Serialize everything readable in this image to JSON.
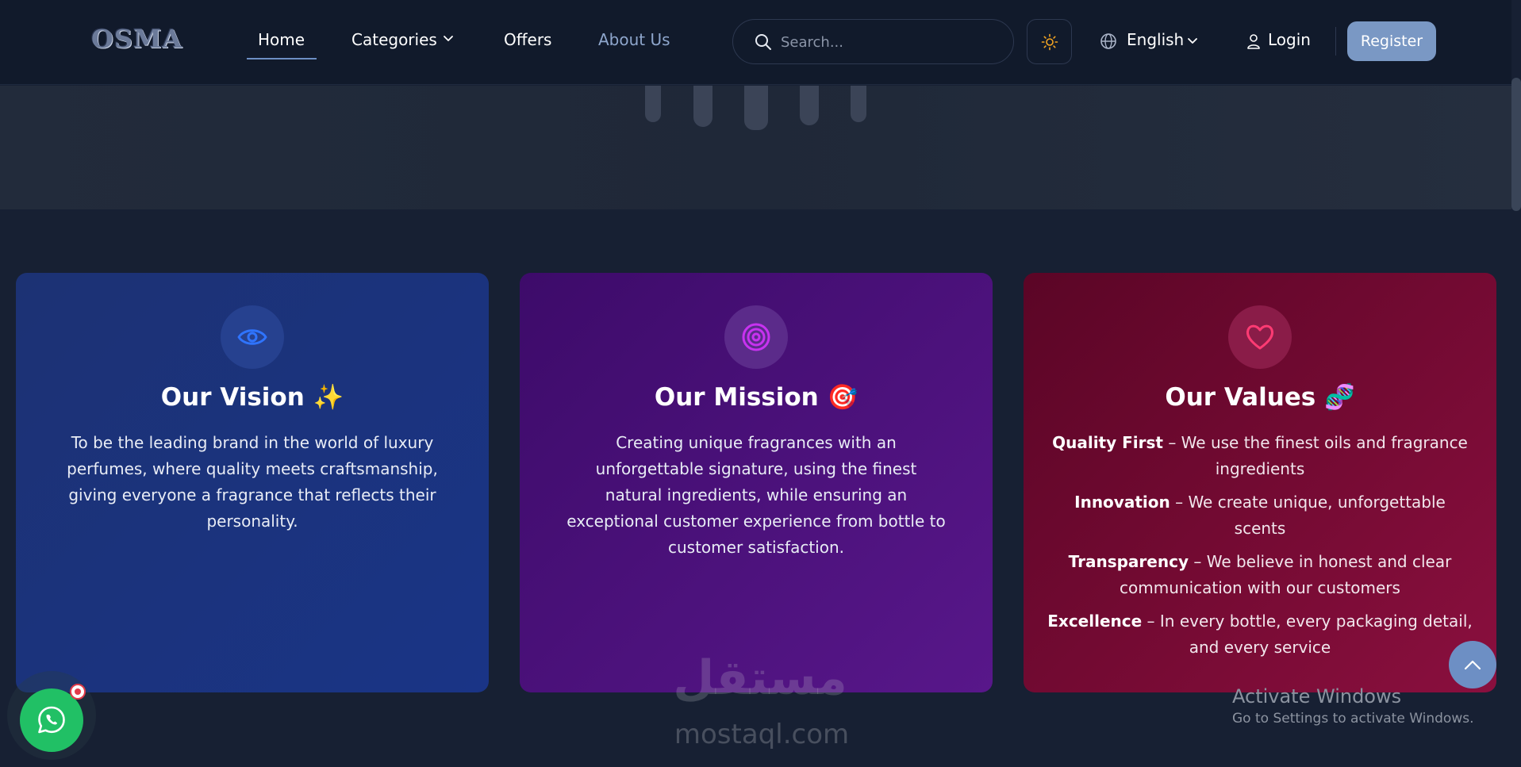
{
  "nav": {
    "logo": "OSMA",
    "links": {
      "home": "Home",
      "categories": "Categories",
      "offers": "Offers",
      "about": "About Us"
    },
    "search_placeholder": "Search...",
    "language": "English",
    "login": "Login",
    "register": "Register"
  },
  "cards": {
    "vision": {
      "title": "Our Vision ✨",
      "body": "To be the leading brand in the world of luxury perfumes, where quality meets craftsmanship, giving everyone a fragrance that reflects their personality."
    },
    "mission": {
      "title": "Our Mission 🎯",
      "body": "Creating unique fragrances with an unforgettable signature, using the finest natural ingredients, while ensuring an exceptional customer experience from bottle to customer satisfaction."
    },
    "values": {
      "title": "Our Values 🧬",
      "items": [
        {
          "name": "Quality First",
          "text": " – We use the finest oils and fragrance ingredients"
        },
        {
          "name": "Innovation",
          "text": " – We create unique, unforgettable scents"
        },
        {
          "name": "Transparency",
          "text": " – We believe in honest and clear communication with our customers"
        },
        {
          "name": "Excellence",
          "text": " – In every bottle, every packaging detail, and every service"
        }
      ]
    }
  },
  "watermark": {
    "arabic": "مستقل",
    "latin": "mostaql.com"
  },
  "windows_activation": {
    "title": "Activate Windows",
    "subtitle": "Go to Settings to activate Windows."
  },
  "icons": {
    "search": "search-icon",
    "theme": "sun-icon",
    "language": "globe-icon",
    "login": "user-icon",
    "vision": "eye-icon",
    "mission": "target-icon",
    "values": "heart-icon",
    "scroll_top": "chevron-up-icon",
    "chat": "whatsapp-icon"
  },
  "colors": {
    "accent": "#7a98c4",
    "vision_card": "#1c3274",
    "mission_card": "#4a1278",
    "values_card": "#750b35",
    "whatsapp": "#21c065"
  }
}
